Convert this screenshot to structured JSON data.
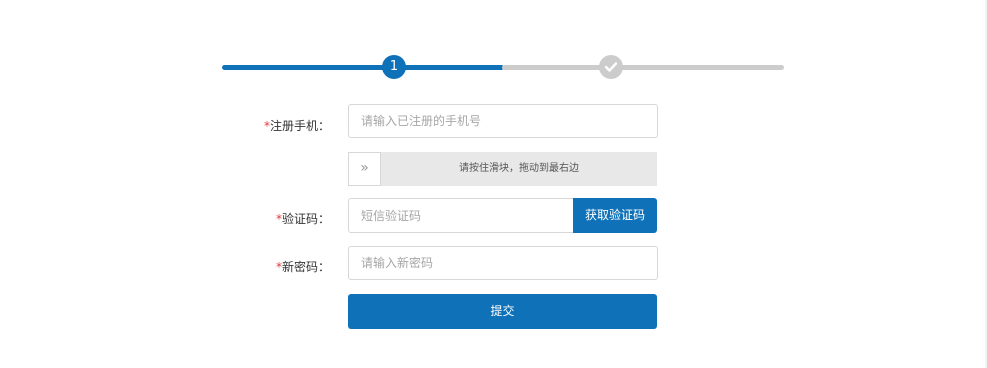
{
  "stepper": {
    "step1_number": "1",
    "step2_icon": "check-icon",
    "current_step": 1,
    "total_steps": 2,
    "colors": {
      "active": "#0f72b8",
      "inactive": "#cccccc"
    }
  },
  "form": {
    "phone": {
      "required_mark": "*",
      "label": "注册手机：",
      "placeholder": "请输入已注册的手机号",
      "value": ""
    },
    "slider": {
      "handle_icon": "double-chevron-right-icon",
      "handle_glyph": "»",
      "text": "请按住滑块，拖动到最右边"
    },
    "code": {
      "required_mark": "*",
      "label": "验证码：",
      "placeholder": "短信验证码",
      "value": "",
      "button_label": "获取验证码"
    },
    "new_password": {
      "required_mark": "*",
      "label": "新密码：",
      "placeholder": "请输入新密码",
      "value": ""
    },
    "submit_label": "提交"
  },
  "colors": {
    "primary": "#0f72b8",
    "required": "#e4393c"
  }
}
